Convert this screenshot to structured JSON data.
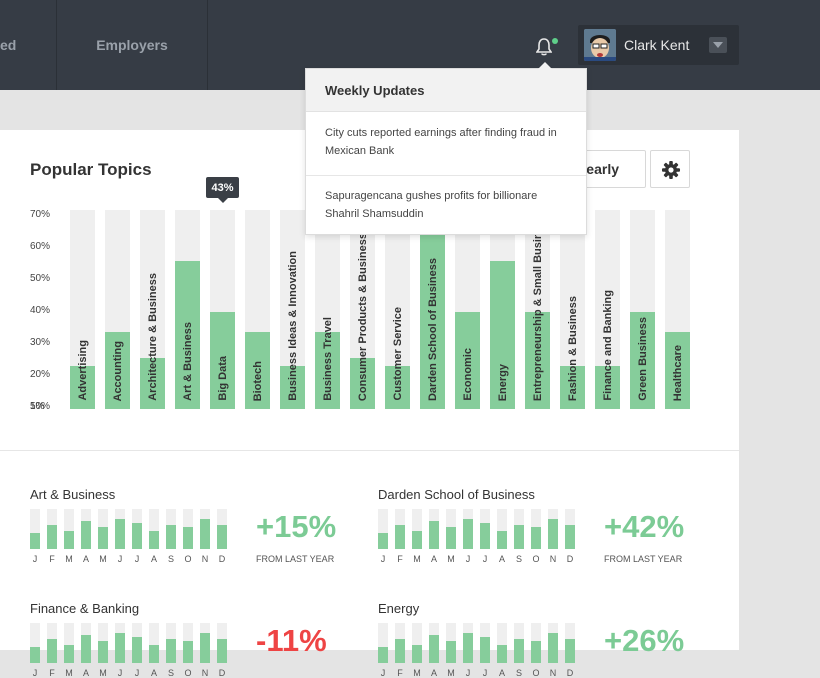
{
  "nav": {
    "items": [
      "ed",
      "Employers"
    ]
  },
  "user": {
    "name": "Clark Kent"
  },
  "panel": {
    "title": "Popular Topics",
    "period_button": "Yearly"
  },
  "tooltip": {
    "value": "43%"
  },
  "colors": {
    "accent_green": "#86cd9b",
    "positive": "#7ccb95",
    "negative": "#ee4444",
    "topbar": "#363c45"
  },
  "chart_data": {
    "type": "bar",
    "title": "Popular Topics",
    "y_ticks": [
      "70%",
      "60%",
      "50%",
      "40%",
      "30%",
      "20%",
      "10%",
      "5%"
    ],
    "categories": [
      "Advertising",
      "Accounting",
      "Architecture & Business",
      "Art & Business",
      "Big Data",
      "Biotech",
      "Business Ideas & Innovation",
      "Business Travel",
      "Consumer Products & Business",
      "Customer Service",
      "Darden School of Business",
      "Economic",
      "Energy",
      "Entrepreneurship & Small Business",
      "Fashion & Business",
      "Finance and Banking",
      "Green Business",
      "Healthcare"
    ],
    "values": [
      15,
      27,
      18,
      52,
      34,
      27,
      15,
      27,
      18,
      15,
      70,
      34,
      52,
      34,
      15,
      15,
      34,
      27
    ],
    "ylim": [
      0,
      70
    ],
    "grid": false
  },
  "dropdown": {
    "title": "Weekly Updates",
    "items": [
      "City cuts reported earnings after finding fraud in Mexican Bank",
      "Sapuragencana gushes profits for billionare Shahril Shamsuddin"
    ]
  },
  "mini_charts": [
    {
      "title": "Art & Business",
      "months": [
        "J",
        "F",
        "M",
        "A",
        "M",
        "J",
        "J",
        "A",
        "S",
        "O",
        "N",
        "D"
      ],
      "values": [
        40,
        60,
        45,
        70,
        55,
        75,
        65,
        45,
        60,
        55,
        75,
        60
      ],
      "change": "+15%",
      "direction": "up",
      "caption": "FROM LAST YEAR"
    },
    {
      "title": "Darden School of Business",
      "months": [
        "J",
        "F",
        "M",
        "A",
        "M",
        "J",
        "J",
        "A",
        "S",
        "O",
        "N",
        "D"
      ],
      "values": [
        40,
        60,
        45,
        70,
        55,
        75,
        65,
        45,
        60,
        55,
        75,
        60
      ],
      "change": "+42%",
      "direction": "up",
      "caption": "FROM LAST YEAR"
    },
    {
      "title": "Finance & Banking",
      "months": [
        "J",
        "F",
        "M",
        "A",
        "M",
        "J",
        "J",
        "A",
        "S",
        "O",
        "N",
        "D"
      ],
      "values": [
        40,
        60,
        45,
        70,
        55,
        75,
        65,
        45,
        60,
        55,
        75,
        60
      ],
      "change": "-11%",
      "direction": "down",
      "caption": ""
    },
    {
      "title": "Energy",
      "months": [
        "J",
        "F",
        "M",
        "A",
        "M",
        "J",
        "J",
        "A",
        "S",
        "O",
        "N",
        "D"
      ],
      "values": [
        40,
        60,
        45,
        70,
        55,
        75,
        65,
        45,
        60,
        55,
        75,
        60
      ],
      "change": "+26%",
      "direction": "up",
      "caption": ""
    }
  ]
}
